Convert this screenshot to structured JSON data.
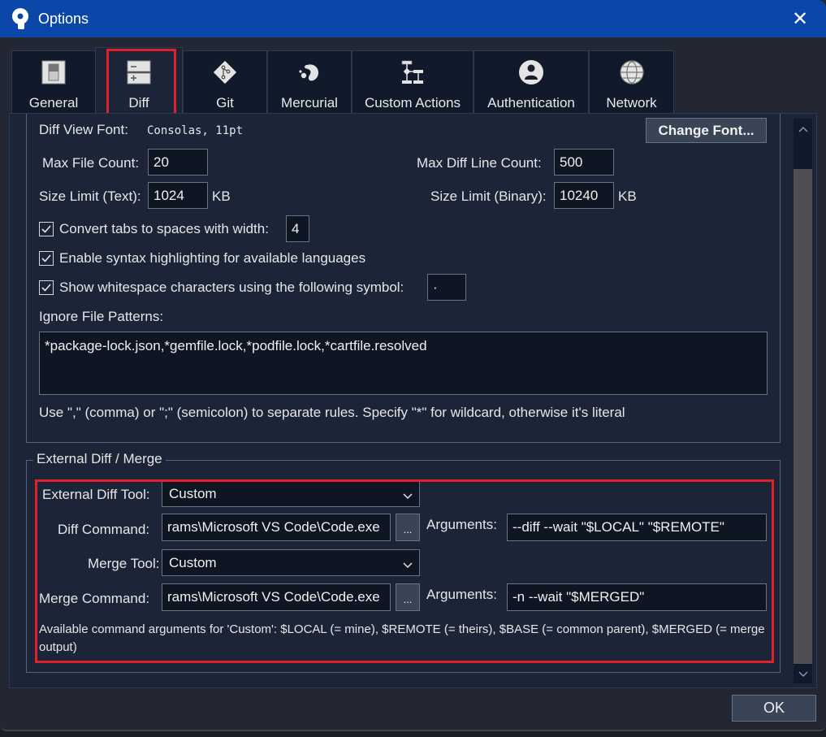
{
  "window": {
    "title": "Options",
    "close_glyph": "✕"
  },
  "tabs": [
    {
      "label": "General",
      "icon": "toggle-switch-icon",
      "active": false
    },
    {
      "label": "Diff",
      "icon": "diff-minus-plus-icon",
      "active": true
    },
    {
      "label": "Git",
      "icon": "git-branch-icon",
      "active": false
    },
    {
      "label": "Mercurial",
      "icon": "mercurial-drop-icon",
      "active": false
    },
    {
      "label": "Custom Actions",
      "icon": "flowchart-icon",
      "active": false
    },
    {
      "label": "Authentication",
      "icon": "user-circle-icon",
      "active": false
    },
    {
      "label": "Network",
      "icon": "globe-icon",
      "active": false
    }
  ],
  "diff": {
    "view_font_label": "Diff View Font:",
    "view_font_value": "Consolas, 11pt",
    "change_font_button": "Change Font...",
    "max_file_count_label": "Max File Count:",
    "max_file_count_value": "20",
    "max_diff_line_count_label": "Max Diff Line Count:",
    "max_diff_line_count_value": "500",
    "size_limit_text_label": "Size Limit (Text):",
    "size_limit_text_value": "1024",
    "size_limit_binary_label": "Size Limit (Binary):",
    "size_limit_binary_value": "10240",
    "unit_kb": "KB",
    "convert_tabs": {
      "label": "Convert tabs to spaces with width:",
      "checked": true,
      "value": "4"
    },
    "syntax_highlighting": {
      "label": "Enable syntax highlighting for available languages",
      "checked": true
    },
    "show_whitespace": {
      "label": "Show whitespace characters using the following symbol:",
      "checked": true,
      "value": "·"
    },
    "ignore_patterns_label": "Ignore File Patterns:",
    "ignore_patterns_value": "*package-lock.json,*gemfile.lock,*podfile.lock,*cartfile.resolved",
    "ignore_patterns_hint": "Use \",\" (comma) or \";\" (semicolon) to separate rules. Specify \"*\" for wildcard, otherwise it's literal"
  },
  "external": {
    "group_title": "External Diff / Merge",
    "diff_tool_label": "External Diff Tool:",
    "diff_tool_value": "Custom",
    "diff_command_label": "Diff Command:",
    "diff_command_value": "rams\\Microsoft VS Code\\Code.exe",
    "browse_label": "...",
    "arguments_label": "Arguments:",
    "diff_arguments_value": "--diff --wait \"$LOCAL\" \"$REMOTE\"",
    "merge_tool_label": "Merge Tool:",
    "merge_tool_value": "Custom",
    "merge_command_label": "Merge Command:",
    "merge_command_value": "rams\\Microsoft VS Code\\Code.exe",
    "merge_arguments_value": "-n --wait \"$MERGED\"",
    "help_text": "Available command arguments for 'Custom': $LOCAL (= mine), $REMOTE (= theirs), $BASE (= common parent), $MERGED (= merge output)"
  },
  "footer": {
    "ok_label": "OK"
  },
  "colors": {
    "titlebar": "#0a47a8",
    "highlight": "#e0202a",
    "panel": "#1c2538",
    "input_bg": "#0e1523"
  }
}
